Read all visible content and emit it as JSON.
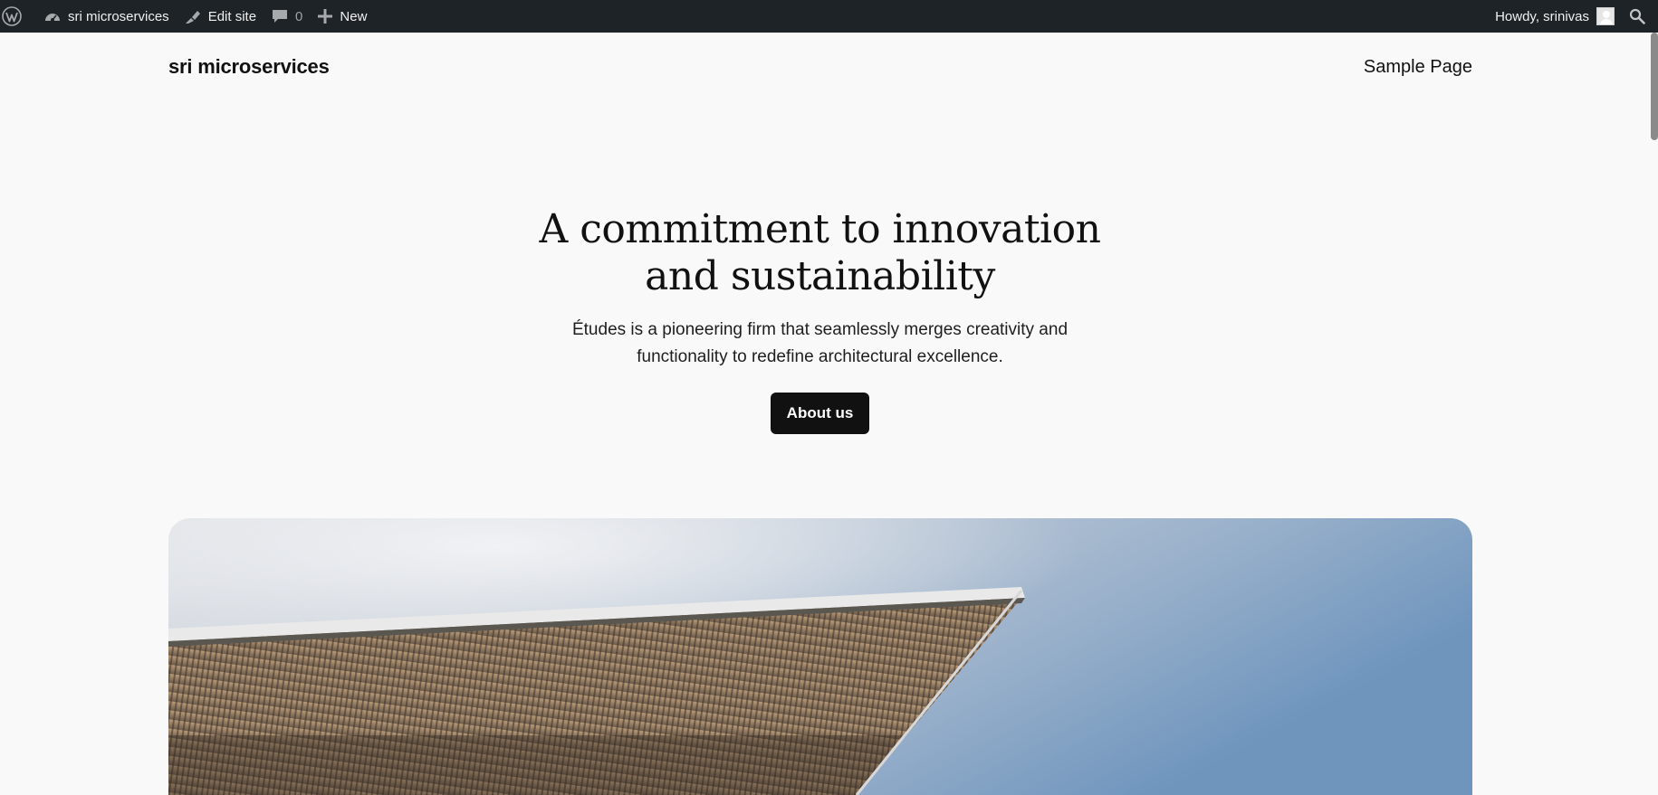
{
  "adminbar": {
    "wp_logo_icon": "wordpress-logo-icon",
    "site_name": "sri microservices",
    "site_icon": "dashboard-icon",
    "edit_site": "Edit site",
    "edit_icon": "brush-icon",
    "comments_count": "0",
    "comments_icon": "comment-icon",
    "new_label": "New",
    "new_icon": "plus-icon",
    "howdy": "Howdy, srinivas",
    "search_icon": "search-icon"
  },
  "header": {
    "site_title": "sri microservices",
    "nav": [
      "Sample Page"
    ]
  },
  "hero": {
    "title": "A commitment to innovation and sustainability",
    "description": "Études is a pioneering firm that seamlessly merges creativity and functionality to redefine architectural excellence.",
    "button_label": "About us"
  },
  "colors": {
    "adminbar_bg": "#1d2327",
    "page_bg": "#f9f9f9",
    "button_bg": "#111111",
    "sky": "#7f9dc0"
  }
}
